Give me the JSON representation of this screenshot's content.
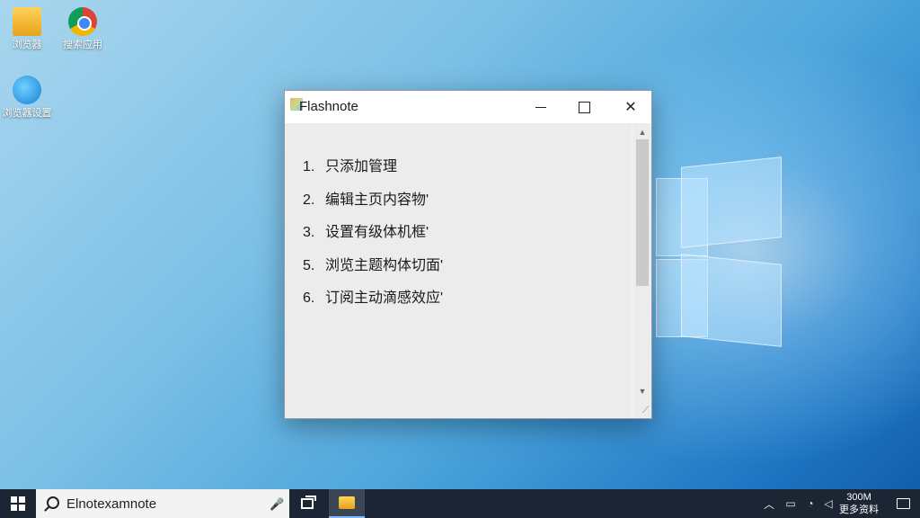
{
  "desktop": {
    "icons": [
      {
        "label": "浏览器",
        "icon": "folder-icon"
      },
      {
        "label": "搜索应用",
        "icon": "chrome-icon"
      },
      {
        "label": "浏览器设置",
        "icon": "ie-icon"
      }
    ]
  },
  "window": {
    "title": "Flashnote",
    "controls": {
      "minimize": "minimize",
      "maximize": "maximize",
      "close": "close"
    },
    "items": [
      {
        "num": "1.",
        "text": "只添加管理"
      },
      {
        "num": "2.",
        "text": "编辑主页内容物'"
      },
      {
        "num": "3.",
        "text": "设置有级体机框'"
      },
      {
        "num": "5.",
        "text": "浏览主题构体切面'"
      },
      {
        "num": "6.",
        "text": "订阅主动滴感效应'"
      }
    ]
  },
  "taskbar": {
    "search_text": "Elnotexamnote",
    "clock_time": "300M",
    "clock_date": "更多资料"
  }
}
